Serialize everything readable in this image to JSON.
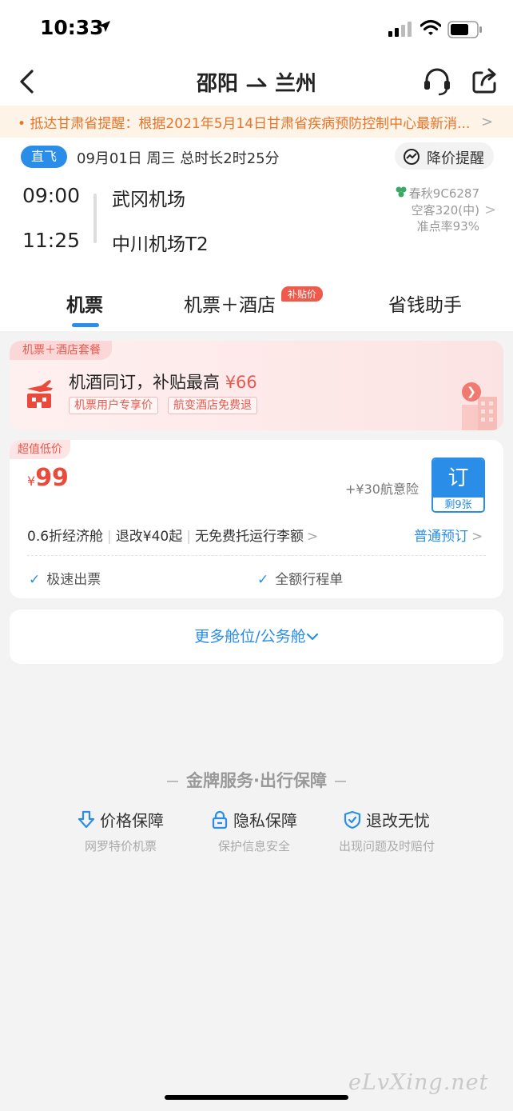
{
  "status_bar": {
    "time": "10:33"
  },
  "nav": {
    "origin": "邵阳",
    "destination": "兰州"
  },
  "notice": {
    "text": "抵达甘肃省提醒：根据2021年5月14日甘肃省疾病预防控制中心最新消..."
  },
  "flight": {
    "direct_label": "直飞",
    "date_info": "09月01日 周三 总时长2时25分",
    "price_alert_label": "降价提醒",
    "dep_time": "09:00",
    "arr_time": "11:25",
    "dep_airport": "武冈机场",
    "arr_airport": "中川机场T2",
    "airline": "春秋9C6287",
    "aircraft": "空客320(中)",
    "on_time": "准点率93%"
  },
  "tabs": [
    {
      "label": "机票"
    },
    {
      "label": "机票＋酒店",
      "badge": "补贴价"
    },
    {
      "label": "省钱助手"
    }
  ],
  "package": {
    "tag": "机票＋酒店套餐",
    "title": "机酒同订，补贴最高",
    "highlight": "¥66",
    "chips": [
      "机票用户专享价",
      "航变酒店免费退"
    ]
  },
  "fare": {
    "tag": "超值低价",
    "currency": "¥",
    "price": "99",
    "insurance": "+¥30航意险",
    "book_label": "订",
    "remaining": "剩9张",
    "cabin": "0.6折经济舱",
    "change": "退改¥40起",
    "baggage": "无免费托运行李额",
    "normal_booking": "普通预订",
    "features": [
      "极速出票",
      "全额行程单"
    ]
  },
  "more_cabins": {
    "label": "更多舱位/公务舱"
  },
  "guarantee": {
    "title": "金牌服务·出行保障",
    "items": [
      {
        "title": "价格保障",
        "subtitle": "网罗特价机票",
        "icon": "price-down-icon"
      },
      {
        "title": "隐私保障",
        "subtitle": "保护信息安全",
        "icon": "lock-icon"
      },
      {
        "title": "退改无忧",
        "subtitle": "出现问题及时赔付",
        "icon": "shield-check-icon"
      }
    ]
  },
  "watermark": "eLvXing.net",
  "colors": {
    "accent": "#2a8ee8",
    "price": "#ea4a3c",
    "notice": "#e8742a"
  }
}
